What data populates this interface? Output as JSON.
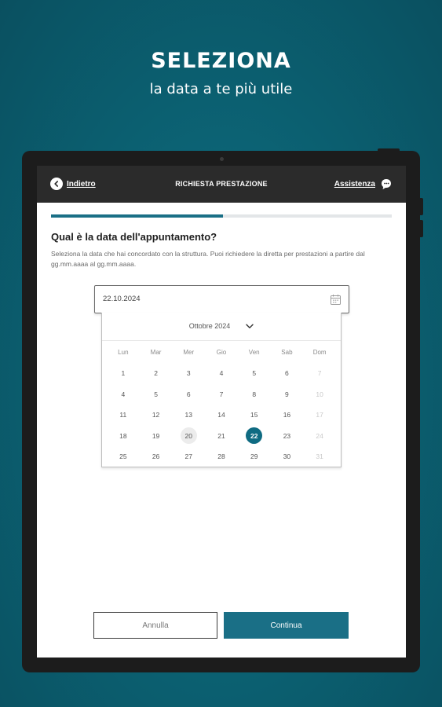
{
  "promo": {
    "title": "SELEZIONA",
    "subtitle": "la data a te più utile"
  },
  "appbar": {
    "back_label": "Indietro",
    "title": "RICHIESTA PRESTAZIONE",
    "assist_label": "Assistenza",
    "back_icon": "chevron-left-icon",
    "assist_icon": "chat-bubble-icon"
  },
  "progress": {
    "value": 0.505
  },
  "form": {
    "question": "Qual è la data dell'appuntamento?",
    "description": "Seleziona la data che hai concordato con la struttura. Puoi richiedere la diretta per prestazioni a partire dal gg.mm.aaaa al gg.mm.aaaa.",
    "date_value": "22.10.2024",
    "calendar_icon": "calendar-icon"
  },
  "calendar": {
    "month_label": "Ottobre 2024",
    "weekdays": [
      "Lun",
      "Mar",
      "Mer",
      "Gio",
      "Ven",
      "Sab",
      "Dom"
    ],
    "today": "20",
    "selected": "22",
    "weeks": [
      [
        "1",
        "2",
        "3",
        "4",
        "5",
        "6",
        "7"
      ],
      [
        "4",
        "5",
        "6",
        "7",
        "8",
        "9",
        "10"
      ],
      [
        "11",
        "12",
        "13",
        "14",
        "15",
        "16",
        "17"
      ],
      [
        "18",
        "19",
        "20",
        "21",
        "22",
        "23",
        "24"
      ],
      [
        "25",
        "26",
        "27",
        "28",
        "29",
        "30",
        "31"
      ]
    ],
    "disabled_column": "Dom"
  },
  "actions": {
    "cancel_label": "Annulla",
    "continue_label": "Continua"
  },
  "colors": {
    "background": "#0b5f70",
    "accent": "#1a6f86",
    "appbar": "#2b2b2b"
  }
}
